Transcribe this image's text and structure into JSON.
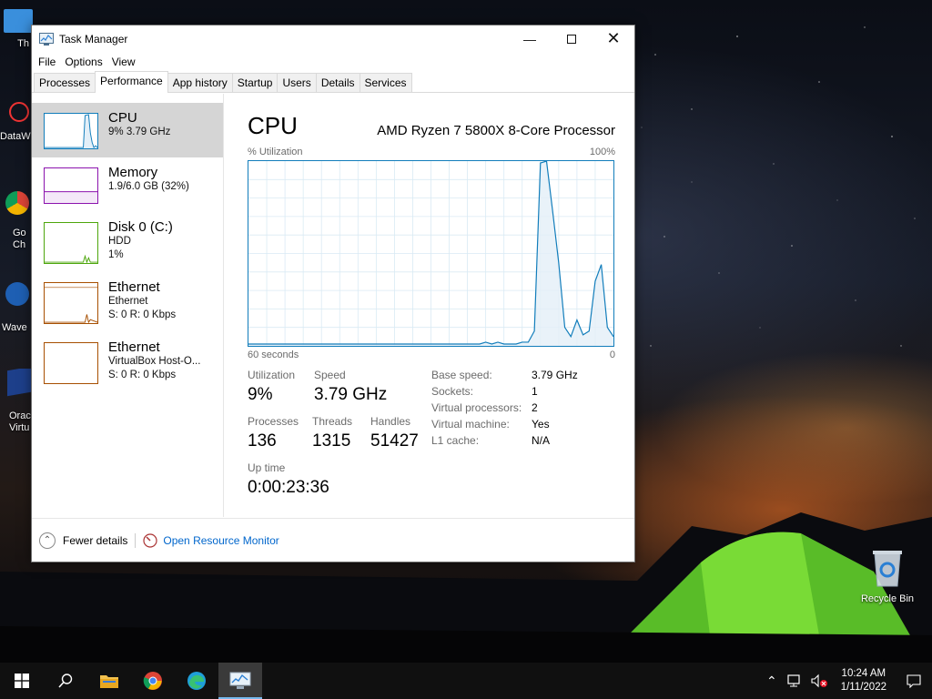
{
  "desktop": {
    "icons": [
      {
        "label": "Th",
        "id": "this-pc"
      },
      {
        "label": "DataW",
        "id": "datawave"
      },
      {
        "label": "Go\nCh",
        "id": "google-chrome"
      },
      {
        "label": "Wave",
        "id": "wave"
      },
      {
        "label": "Orac\nVirtu",
        "id": "oracle-virtualbox"
      }
    ],
    "recycle_bin_label": "Recycle Bin"
  },
  "window": {
    "title": "Task Manager",
    "menu": [
      "File",
      "Options",
      "View"
    ],
    "tabs": [
      "Processes",
      "Performance",
      "App history",
      "Startup",
      "Users",
      "Details",
      "Services"
    ],
    "active_tab": "Performance"
  },
  "sidebar": {
    "items": [
      {
        "name": "CPU",
        "sub1": "9%  3.79 GHz",
        "sub2": "",
        "color": "#117dbb"
      },
      {
        "name": "Memory",
        "sub1": "1.9/6.0 GB (32%)",
        "sub2": "",
        "color": "#8b12ae"
      },
      {
        "name": "Disk 0 (C:)",
        "sub1": "HDD",
        "sub2": "1%",
        "color": "#4da60c"
      },
      {
        "name": "Ethernet",
        "sub1": "Ethernet",
        "sub2": "S: 0  R: 0 Kbps",
        "color": "#a74f01"
      },
      {
        "name": "Ethernet",
        "sub1": "VirtualBox Host-O...",
        "sub2": "S: 0  R: 0 Kbps",
        "color": "#a74f01"
      }
    ]
  },
  "cpu": {
    "title": "CPU",
    "processor": "AMD Ryzen 7 5800X 8-Core Processor",
    "util_label": "% Utilization",
    "util_max": "100%",
    "time_left": "60 seconds",
    "time_right": "0",
    "stats": {
      "utilization_label": "Utilization",
      "utilization": "9%",
      "speed_label": "Speed",
      "speed": "3.79 GHz",
      "processes_label": "Processes",
      "processes": "136",
      "threads_label": "Threads",
      "threads": "1315",
      "handles_label": "Handles",
      "handles": "51427",
      "uptime_label": "Up time",
      "uptime": "0:00:23:36"
    },
    "specs": [
      {
        "k": "Base speed:",
        "v": "3.79 GHz"
      },
      {
        "k": "Sockets:",
        "v": "1"
      },
      {
        "k": "Virtual processors:",
        "v": "2"
      },
      {
        "k": "Virtual machine:",
        "v": "Yes"
      },
      {
        "k": "L1 cache:",
        "v": "N/A"
      }
    ]
  },
  "chart_data": {
    "type": "area",
    "title": "CPU",
    "xlabel": "",
    "ylabel": "% Utilization",
    "xlim": [
      60,
      0
    ],
    "ylim": [
      0,
      100
    ],
    "grid": true,
    "x": [
      60,
      59,
      58,
      57,
      56,
      55,
      54,
      53,
      52,
      51,
      50,
      49,
      48,
      47,
      46,
      45,
      44,
      43,
      42,
      41,
      40,
      39,
      38,
      37,
      36,
      35,
      34,
      33,
      32,
      31,
      30,
      29,
      28,
      27,
      26,
      25,
      24,
      23,
      22,
      21,
      20,
      19,
      18,
      17,
      16,
      15,
      14,
      13,
      12,
      11,
      10,
      9,
      8,
      7,
      6,
      5,
      4,
      3,
      2,
      1,
      0
    ],
    "values": [
      1,
      1,
      1,
      1,
      1,
      1,
      1,
      1,
      1,
      1,
      1,
      1,
      1,
      1,
      1,
      1,
      1,
      1,
      1,
      1,
      1,
      1,
      1,
      1,
      1,
      1,
      1,
      1,
      1,
      1,
      1,
      1,
      1,
      1,
      1,
      1,
      1,
      1,
      1,
      2,
      1,
      2,
      1,
      1,
      1,
      2,
      2,
      8,
      99,
      100,
      73,
      45,
      10,
      5,
      14,
      6,
      8,
      35,
      44,
      10,
      5
    ],
    "series_color": "#117dbb"
  },
  "footer": {
    "fewer_details": "Fewer details",
    "open_resource_monitor": "Open Resource Monitor"
  },
  "taskbar": {
    "time": "10:24 AM",
    "date": "1/11/2022"
  }
}
